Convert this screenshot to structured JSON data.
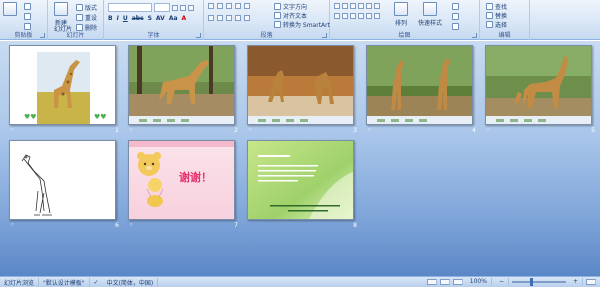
{
  "ribbon": {
    "groups": [
      {
        "label": "剪贴板",
        "items": [
          "粘贴",
          "剪切",
          "复制",
          "格式刷"
        ]
      },
      {
        "label": "幻灯片",
        "items": [
          "新建",
          "幻灯片",
          "版式",
          "重设",
          "删除"
        ]
      },
      {
        "label": "字体",
        "items": [
          "B",
          "I",
          "U",
          "abc",
          "S",
          "AV",
          "Aa",
          "A"
        ]
      },
      {
        "label": "段落",
        "items": [
          "文字方向",
          "对齐文本",
          "转换为 SmartArt"
        ]
      },
      {
        "label": "绘图",
        "items": [
          "排列",
          "快速样式"
        ]
      },
      {
        "label": "编辑",
        "items": [
          "查找",
          "替换",
          "选择"
        ]
      }
    ]
  },
  "slides": [
    {
      "number": "1",
      "transition": "☆",
      "art": "giraffe-cutout"
    },
    {
      "number": "2",
      "transition": "☆",
      "art": "giraffe-photo"
    },
    {
      "number": "3",
      "transition": "☆",
      "art": "giraffes-drinking"
    },
    {
      "number": "4",
      "transition": "☆",
      "art": "two-giraffes"
    },
    {
      "number": "5",
      "transition": "☆",
      "art": "giraffe-grazing"
    },
    {
      "number": "6",
      "transition": "☆",
      "art": "giraffe-sketch"
    },
    {
      "number": "7",
      "transition": "☆",
      "art": "thanks",
      "text": "谢谢！"
    },
    {
      "number": "8",
      "transition": "",
      "art": "info-card"
    }
  ],
  "status": {
    "view": "幻灯片浏览",
    "theme": "\"默认设计模板\"",
    "language": "中文(简体，中国)",
    "zoom": "100%"
  },
  "colors": {
    "ribbon_bg": "#d8e6f6",
    "workspace_top": "#c8dbf1",
    "workspace_bottom": "#5b87c7",
    "accent_pink": "#e8336d"
  }
}
